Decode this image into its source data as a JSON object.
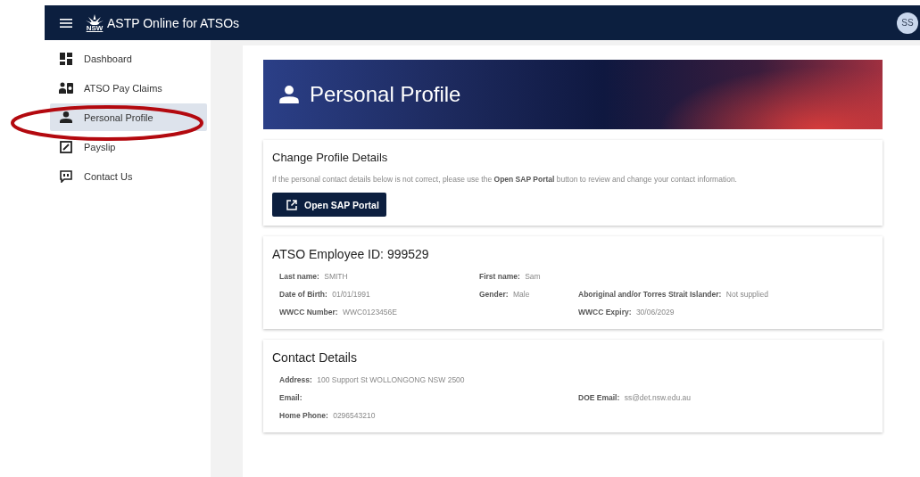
{
  "header": {
    "title": "ASTP Online for ATSOs",
    "logo_text": "NSW",
    "avatar": "SS"
  },
  "sidebar": {
    "items": [
      {
        "label": "Dashboard",
        "selected": false
      },
      {
        "label": "ATSO Pay Claims",
        "selected": false
      },
      {
        "label": "Personal Profile",
        "selected": true
      },
      {
        "label": "Payslip",
        "selected": false
      },
      {
        "label": "Contact Us",
        "selected": false
      }
    ]
  },
  "banner": {
    "title": "Personal Profile"
  },
  "change_card": {
    "title": "Change Profile Details",
    "text": "If the personal contact details below is not correct, please use the **Open SAP Portal** button to review and change your contact information.",
    "button": "Open SAP Portal"
  },
  "employee_card": {
    "title": "ATSO Employee ID: 999529",
    "rows": [
      [
        {
          "label": "Last name:",
          "value": "SMITH"
        },
        {
          "label": "First name:",
          "value": "Sam"
        },
        ""
      ],
      [
        {
          "label": "Date of Birth:",
          "value": "01/01/1991"
        },
        {
          "label": "Gender:",
          "value": "Male"
        },
        {
          "label": "Aboriginal and/or Torres Strait Islander:",
          "value": "Not supplied"
        }
      ],
      [
        {
          "label": "WWCC Number:",
          "value": "WWC0123456E"
        },
        "",
        {
          "label": "WWCC Expiry:",
          "value": "30/06/2029"
        }
      ]
    ]
  },
  "contact_card": {
    "title": "Contact Details",
    "rows": [
      [
        {
          "label": "Address:",
          "value": "100 Support St WOLLONGONG NSW 2500"
        },
        "",
        ""
      ],
      [
        {
          "label": "Email:"
        },
        "",
        {
          "label": "DOE Email:",
          "value": "ss@det.nsw.edu.au"
        }
      ],
      [
        {
          "label": "Home Phone:",
          "value": "0296543210"
        },
        "",
        ""
      ]
    ]
  }
}
